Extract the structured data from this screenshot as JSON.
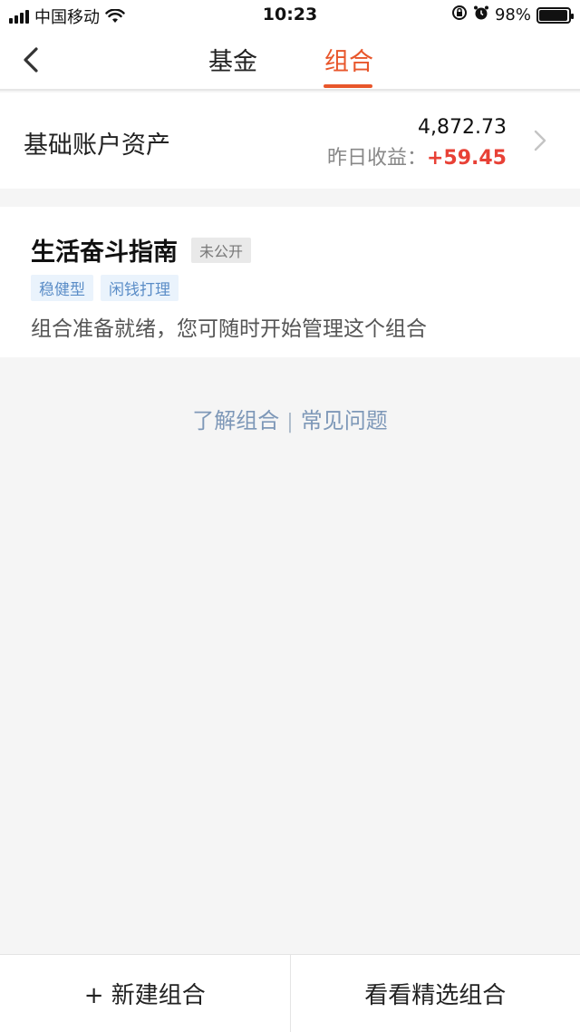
{
  "status_bar": {
    "carrier": "中国移动",
    "time": "10:23",
    "battery_percent": "98%",
    "battery_level": 0.98,
    "icons": [
      "signal-icon",
      "wifi-icon",
      "lock-rotation-icon",
      "alarm-icon",
      "battery-icon"
    ]
  },
  "nav": {
    "tabs": [
      {
        "label": "基金",
        "active": false
      },
      {
        "label": "组合",
        "active": true
      }
    ],
    "accent_color": "#e8562b"
  },
  "account": {
    "title": "基础账户资产",
    "amount": "4,872.73",
    "earnings_label": "昨日收益：",
    "earnings_value": "+59.45"
  },
  "portfolio": {
    "name": "生活奋斗指南",
    "visibility_badge": "未公开",
    "tags": [
      "稳健型",
      "闲钱打理"
    ],
    "description": "组合准备就绪，您可随时开始管理这个组合"
  },
  "help": {
    "learn_link": "了解组合",
    "separator": "|",
    "faq_link": "常见问题"
  },
  "bottom_bar": {
    "create_button": "+ 新建组合",
    "browse_button": "看看精选组合"
  }
}
